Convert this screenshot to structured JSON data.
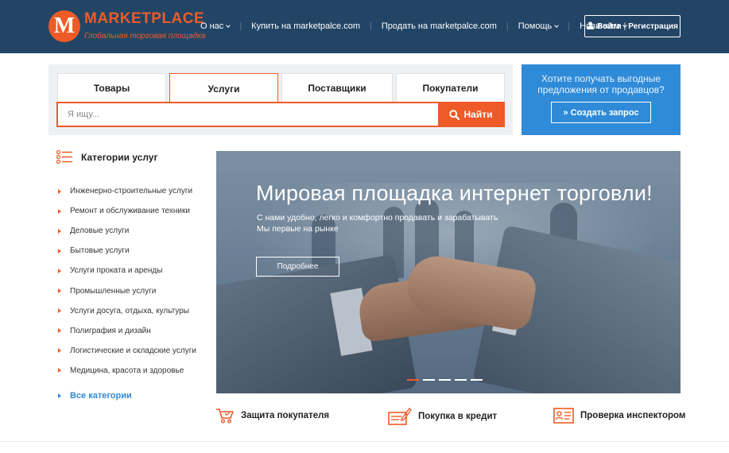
{
  "header": {
    "logo_letter": "M",
    "logo_name": "MARKETPLACE",
    "logo_tagline": "Глобальная торговая площадка",
    "nav": [
      {
        "label": "О нас",
        "dropdown": true
      },
      {
        "label": "Купить на marketpalce.com",
        "dropdown": false
      },
      {
        "label": "Продать на marketpalce.com",
        "dropdown": false
      },
      {
        "label": "Помощь",
        "dropdown": true
      },
      {
        "label": "Новичкам",
        "dropdown": true
      }
    ],
    "login_label": "Войти",
    "register_label": "Регистрация"
  },
  "search": {
    "tabs": [
      "Товары",
      "Услуги",
      "Поставщики",
      "Покупатели"
    ],
    "active_tab": "Услуги",
    "placeholder": "Я ищу...",
    "button_label": "Найти"
  },
  "promo": {
    "text": "Хотите получать выгодные предложения от продавцов?",
    "button_label": "Создать запрос"
  },
  "sidebar": {
    "title": "Категории услуг",
    "items": [
      "Инженерно-строительные услуги",
      "Ремонт и обслуживание техники",
      "Деловые услуги",
      "Бытовые услуги",
      "Услуги проката и аренды",
      "Промышленные услуги",
      "Услуги досуга, отдыха, культуры",
      "Полиграфия и дизайн",
      "Логистические и складские услуги",
      "Медицина, красота и здоровье"
    ],
    "all_label": "Все категории"
  },
  "hero": {
    "title": "Мировая площадка интернет торговли!",
    "subtitle_line1": "С нами удобно, легко и комфортно продавать и зарабатывать",
    "subtitle_line2": "Мы первые на рынке",
    "button_label": "Подробнее",
    "slides_count": 5,
    "active_slide": 1
  },
  "features": [
    {
      "label": "Защита покупателя",
      "icon": "cart-shield-icon"
    },
    {
      "label": "Покупка в кредит",
      "icon": "credit-form-icon"
    },
    {
      "label": "Проверка инспектором",
      "icon": "inspection-card-icon"
    }
  ],
  "colors": {
    "header_bg": "#224566",
    "accent": "#ee5b27",
    "promo_bg": "#2f8bd8",
    "panel_bg": "#eef0f3"
  }
}
